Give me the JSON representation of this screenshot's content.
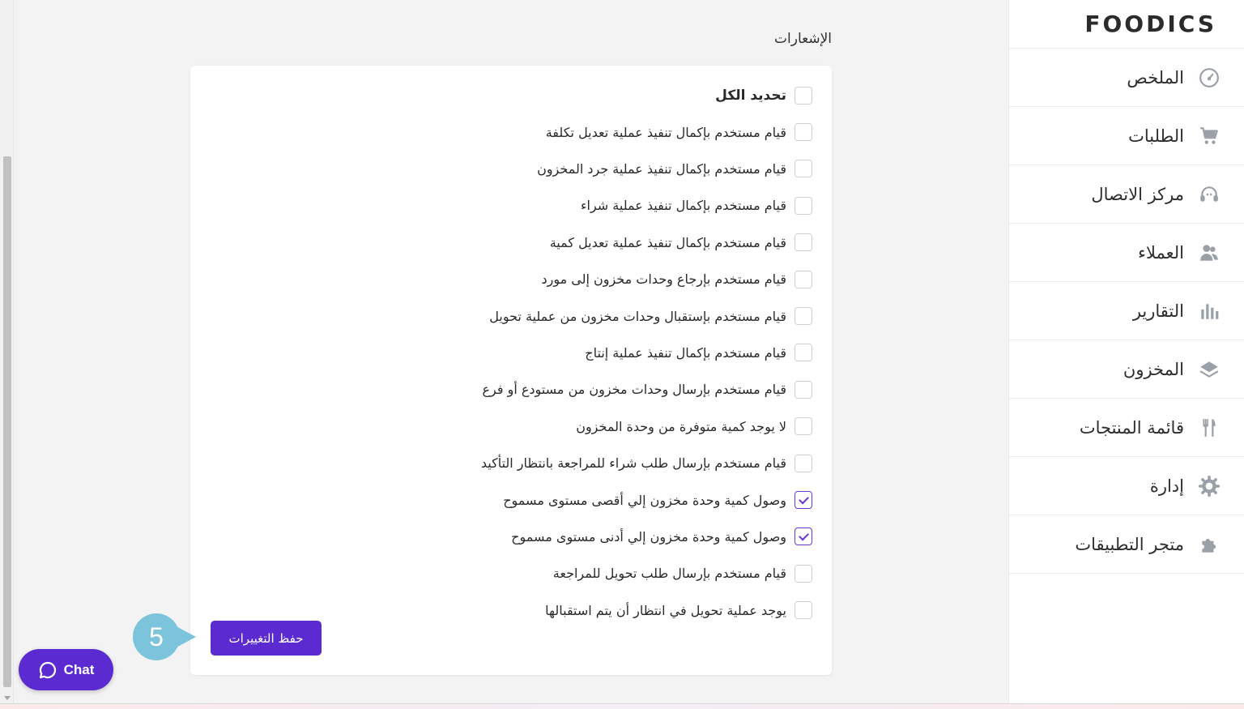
{
  "brand": {
    "logo_text": "FOODICS"
  },
  "sidebar": {
    "items": [
      {
        "label": "الملخص",
        "icon": "dashboard-gauge-icon"
      },
      {
        "label": "الطلبات",
        "icon": "cart-icon"
      },
      {
        "label": "مركز الاتصال",
        "icon": "headset-icon"
      },
      {
        "label": "العملاء",
        "icon": "customers-icon"
      },
      {
        "label": "التقارير",
        "icon": "bar-chart-icon"
      },
      {
        "label": "المخزون",
        "icon": "layers-icon"
      },
      {
        "label": "قائمة المنتجات",
        "icon": "fork-knife-icon"
      },
      {
        "label": "إدارة",
        "icon": "gear-icon"
      },
      {
        "label": "متجر التطبيقات",
        "icon": "puzzle-icon"
      }
    ]
  },
  "notifications": {
    "title": "الإشعارات",
    "select_all": {
      "label": "تحديد الكل",
      "checked": false
    },
    "items": [
      {
        "label": "قيام مستخدم بإكمال تنفيذ عملية تعديل تكلفة",
        "checked": false
      },
      {
        "label": "قيام مستخدم بإكمال تنفيذ عملية جرد المخزون",
        "checked": false
      },
      {
        "label": "قيام مستخدم بإكمال تنفيذ عملية شراء",
        "checked": false
      },
      {
        "label": "قيام مستخدم بإكمال تنفيذ عملية تعديل كمية",
        "checked": false
      },
      {
        "label": "قيام مستخدم بإرجاع وحدات مخزون إلى مورد",
        "checked": false
      },
      {
        "label": "قيام مستخدم بإستقبال وحدات مخزون من عملية تحويل",
        "checked": false
      },
      {
        "label": "قيام مستخدم بإكمال تنفيذ عملية إنتاج",
        "checked": false
      },
      {
        "label": "قيام مستخدم بإرسال وحدات مخزون من مستودع أو فرع",
        "checked": false
      },
      {
        "label": "لا يوجد كمية متوفرة من وحدة المخزون",
        "checked": false
      },
      {
        "label": "قيام مستخدم بإرسال طلب شراء للمراجعة بانتظار التأكيد",
        "checked": false
      },
      {
        "label": "وصول كمية وحدة مخزون إلي أقصى مستوى مسموح",
        "checked": true
      },
      {
        "label": "وصول كمية وحدة مخزون إلي أدنى مستوى مسموح",
        "checked": true
      },
      {
        "label": "قيام مستخدم بإرسال طلب تحويل للمراجعة",
        "checked": false
      },
      {
        "label": "يوجد عملية تحويل في انتظار أن يتم استقبالها",
        "checked": false
      }
    ],
    "save_label": "حفظ التغييرات"
  },
  "step_badge": {
    "number": "5",
    "color": "#7bc4dc"
  },
  "chat": {
    "label": "Chat",
    "icon": "chat-bubble-icon"
  },
  "colors": {
    "accent": "#5b2bd1",
    "background": "#f3f3f4",
    "card": "#ffffff"
  }
}
